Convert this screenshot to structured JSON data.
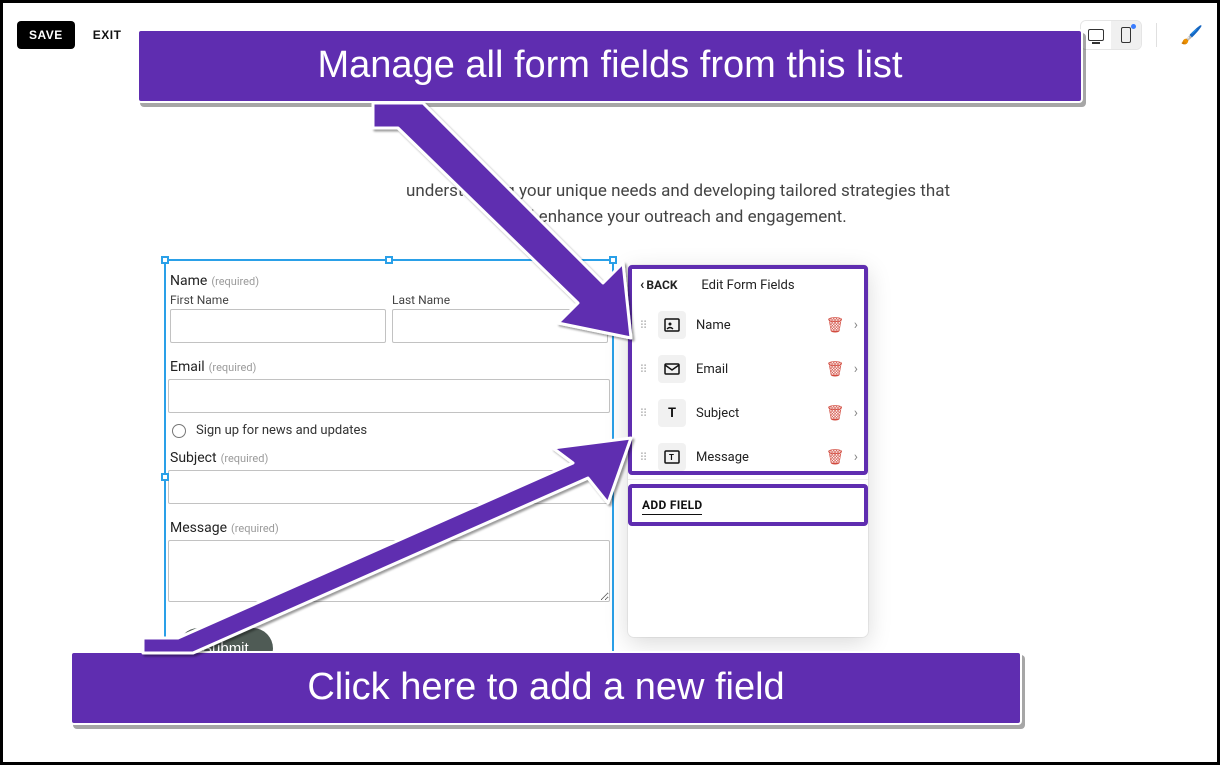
{
  "toolbar": {
    "save_label": "SAVE",
    "exit_label": "EXIT"
  },
  "body_text": "understanding your unique needs and developing tailored strategies that will enhance your outreach and engagement.",
  "form": {
    "required_label": "(required)",
    "name": {
      "label": "Name",
      "first_sub": "First Name",
      "last_sub": "Last Name"
    },
    "email": {
      "label": "Email"
    },
    "signup_label": "Sign up for news and updates",
    "subject": {
      "label": "Subject"
    },
    "message": {
      "label": "Message"
    },
    "submit_label": "Submit"
  },
  "panel": {
    "back_label": "BACK",
    "title": "Edit Form Fields",
    "fields": {
      "0": {
        "name": "Name"
      },
      "1": {
        "name": "Email"
      },
      "2": {
        "name": "Subject"
      },
      "3": {
        "name": "Message"
      }
    },
    "add_field_label": "ADD FIELD"
  },
  "callouts": {
    "top": "Manage all form fields from this list",
    "bottom": "Click here to add a new field"
  }
}
